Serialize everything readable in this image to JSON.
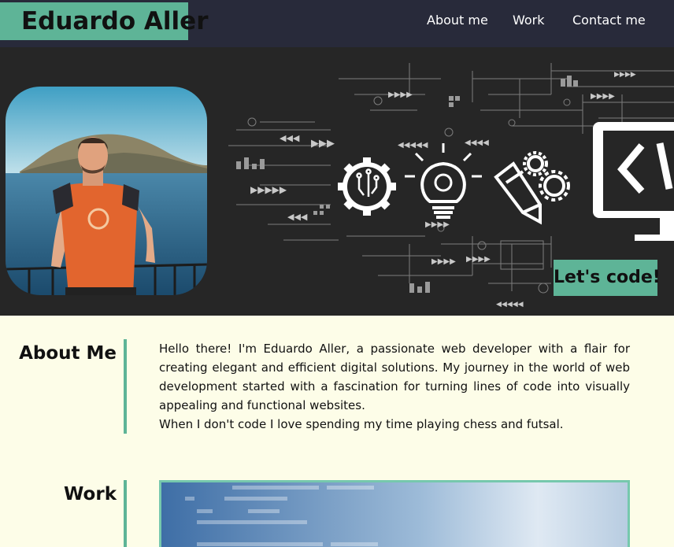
{
  "header": {
    "brand": "Eduardo Aller",
    "nav": [
      "About me",
      "Work",
      "Contact me"
    ]
  },
  "hero": {
    "cta": "Let's code!"
  },
  "about": {
    "title": "About Me",
    "paragraph_1": "Hello there! I'm Eduardo Aller, a passionate web developer with a flair for creating elegant and efficient digital solutions. My journey in the world of web development started with a fascination for turning lines of code into visually appealing and functional websites.",
    "paragraph_2": "When I don't code I love spending my time playing chess and futsal."
  },
  "work": {
    "title": "Work"
  },
  "colors": {
    "header_bg": "#282a3a",
    "accent": "#5eb497",
    "page_bg": "#fdfde8",
    "hero_bg": "#262626"
  }
}
